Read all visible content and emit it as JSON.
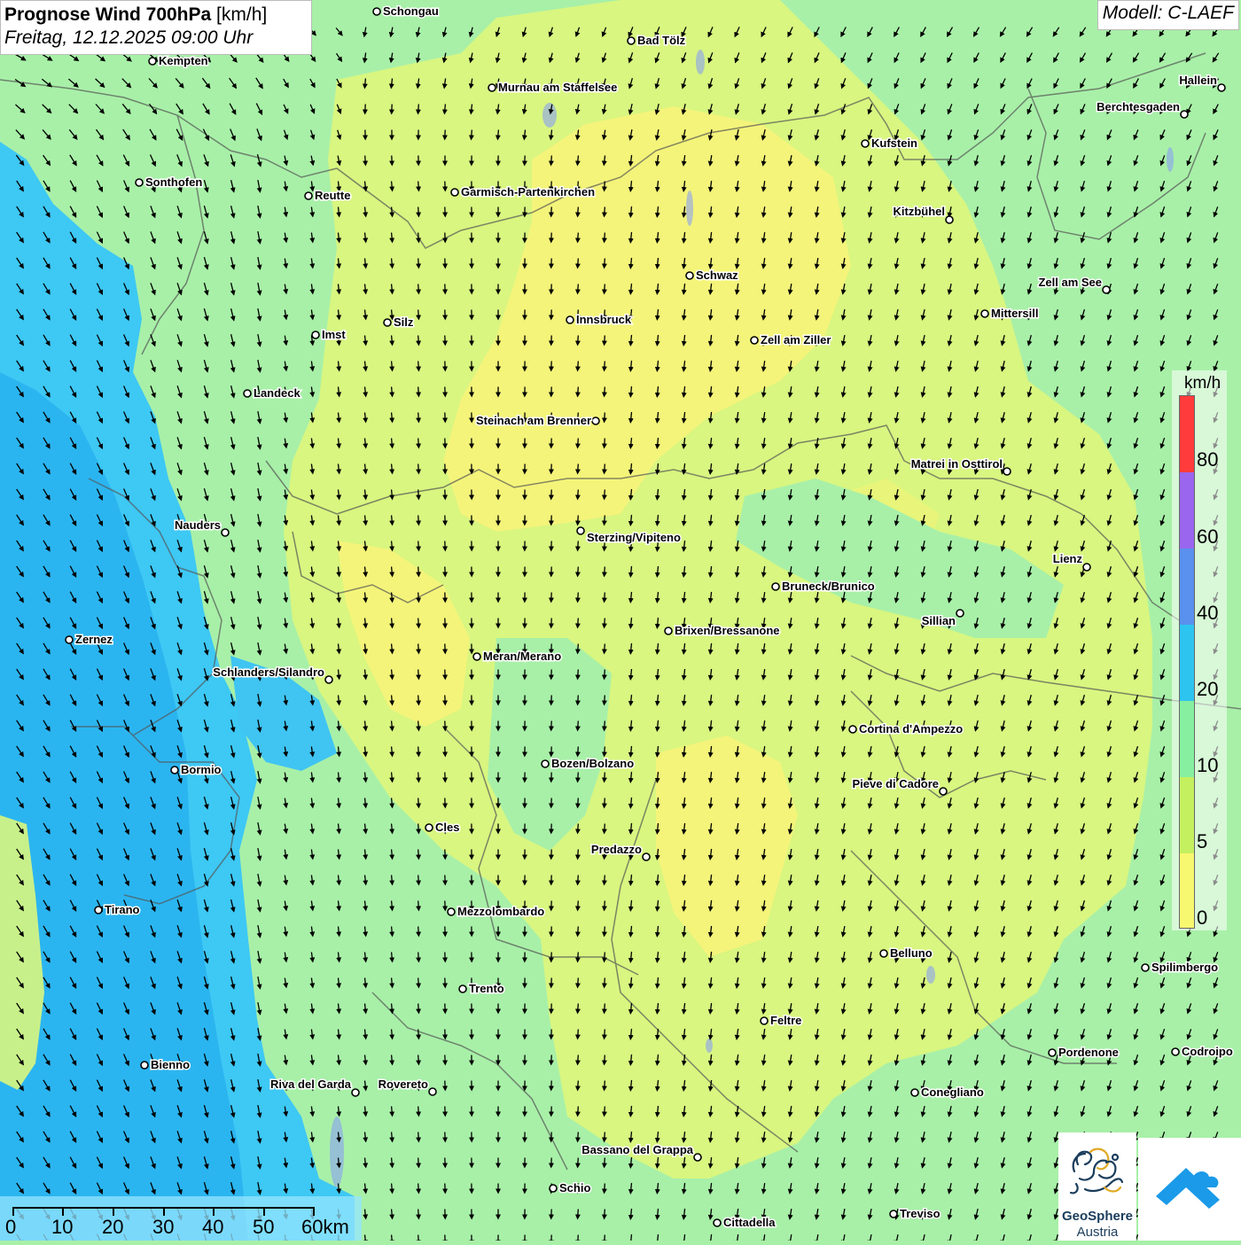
{
  "header": {
    "title_bold": "Prognose Wind 700hPa",
    "title_unit": "[km/h]",
    "datetime": "Freitag, 12.12.2025 09:00 Uhr",
    "model": "Modell: C-LAEF"
  },
  "legend": {
    "unit": "km/h",
    "labels": [
      "80",
      "60",
      "40",
      "20",
      "10",
      "5",
      "0"
    ],
    "colors": [
      "#ff3b3b",
      "#9a66ee",
      "#5a90ee",
      "#2ec4f0",
      "#86f0a0",
      "#c4f060",
      "#f8f870"
    ]
  },
  "scalebar": {
    "labels": [
      "0",
      "10",
      "20",
      "30",
      "40",
      "50",
      "60km"
    ]
  },
  "logo": {
    "name_line1": "GeoSphere",
    "name_line2": "Austria"
  },
  "cities": [
    {
      "name": "Schongau"
    },
    {
      "name": "Bad Tölz"
    },
    {
      "name": "Kempten"
    },
    {
      "name": "Murnau am Staffelsee"
    },
    {
      "name": "Hallein"
    },
    {
      "name": "Berchtesgaden"
    },
    {
      "name": "Kufstein"
    },
    {
      "name": "Sonthofen"
    },
    {
      "name": "Reutte"
    },
    {
      "name": "Garmisch-Partenkirchen"
    },
    {
      "name": "Kitzbühel"
    },
    {
      "name": "Schwaz"
    },
    {
      "name": "Zell am See"
    },
    {
      "name": "Mittersill"
    },
    {
      "name": "Innsbruck"
    },
    {
      "name": "Silz"
    },
    {
      "name": "Imst"
    },
    {
      "name": "Zell am Ziller"
    },
    {
      "name": "Landeck"
    },
    {
      "name": "Steinach am Brenner"
    },
    {
      "name": "Matrei in Osttirol"
    },
    {
      "name": "Nauders"
    },
    {
      "name": "Sterzing/Vipiteno"
    },
    {
      "name": "Lienz"
    },
    {
      "name": "Bruneck/Brunico"
    },
    {
      "name": "Sillian"
    },
    {
      "name": "Zernez"
    },
    {
      "name": "Brixen/Bressanone"
    },
    {
      "name": "Meran/Merano"
    },
    {
      "name": "Schlanders/Silandro"
    },
    {
      "name": "Cortina d'Ampezzo"
    },
    {
      "name": "Bozen/Bolzano"
    },
    {
      "name": "Bormio"
    },
    {
      "name": "Pieve di Cadore"
    },
    {
      "name": "Cles"
    },
    {
      "name": "Predazzo"
    },
    {
      "name": "Tirano"
    },
    {
      "name": "Mezzolombardo"
    },
    {
      "name": "Belluno"
    },
    {
      "name": "Spilimbergo"
    },
    {
      "name": "Trento"
    },
    {
      "name": "Feltre"
    },
    {
      "name": "Pordenone"
    },
    {
      "name": "Codroipo"
    },
    {
      "name": "Bienno"
    },
    {
      "name": "Riva del Garda"
    },
    {
      "name": "Rovereto"
    },
    {
      "name": "Conegliano"
    },
    {
      "name": "Bassano del Grappa"
    },
    {
      "name": "Schio"
    },
    {
      "name": "Treviso"
    },
    {
      "name": "Cittadella"
    }
  ]
}
